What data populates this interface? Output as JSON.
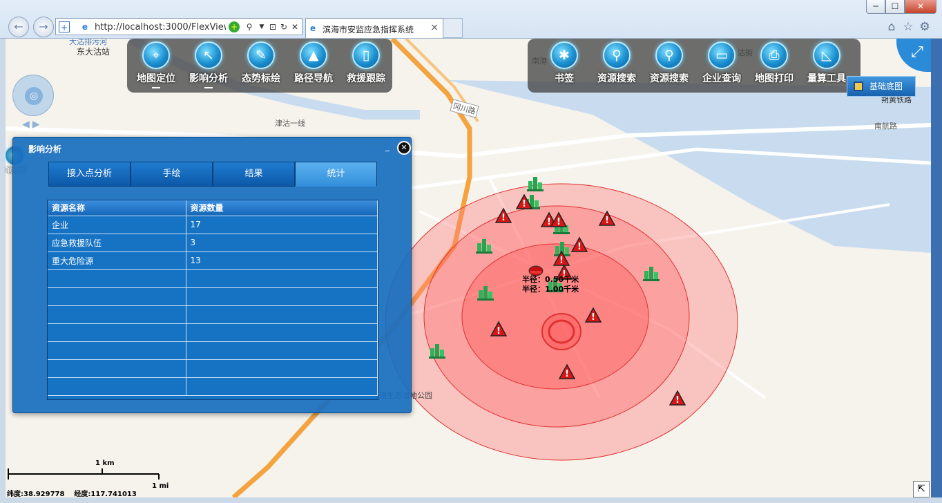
{
  "window": {
    "min": "─",
    "max": "☐",
    "close": "✕"
  },
  "browser": {
    "back_icon": "back-arrow-icon",
    "forward_icon": "forward-arrow-icon",
    "url": "http://localhost:3000/FlexViewer,",
    "tab_title": "滨海市安监应急指挥系统",
    "tab_close": "×",
    "search_glyph": "⚲",
    "refresh_glyph": "↻",
    "stop_glyph": "✕"
  },
  "map_labels": {
    "station": "东大沽站",
    "station_cut": "大沽排污河",
    "road1": "津沽一线",
    "road2": "冈川路",
    "road3": "南航路",
    "road4": "朔黄铁路",
    "road5": "南港",
    "road6": "沽街",
    "park": "临港生态湿地公园",
    "circle_text_1": "半径：0.50千米",
    "circle_text_2": "半径：1.00千米"
  },
  "toolbar_left": [
    {
      "label": "地图定位",
      "icon": "crosshair-icon",
      "glyph": "⌖",
      "active": true
    },
    {
      "label": "影响分析",
      "icon": "pointer-icon",
      "glyph": "↖",
      "active": true
    },
    {
      "label": "态势标绘",
      "icon": "pencil-icon",
      "glyph": "✎",
      "active": false
    },
    {
      "label": "路径导航",
      "icon": "navigation-arrow-icon",
      "glyph": "▲",
      "active": false
    },
    {
      "label": "救援跟踪",
      "icon": "phone-icon",
      "glyph": "▯",
      "active": false
    }
  ],
  "toolbar_right": [
    {
      "label": "书签",
      "icon": "maple-leaf-icon",
      "glyph": "✱"
    },
    {
      "label": "资源搜索",
      "icon": "search-map-icon",
      "glyph": "⚲"
    },
    {
      "label": "资源搜索",
      "icon": "search-map-icon",
      "glyph": "⚲"
    },
    {
      "label": "企业查询",
      "icon": "camera-icon",
      "glyph": "▭"
    },
    {
      "label": "地图打印",
      "icon": "printer-icon",
      "glyph": "⎙"
    },
    {
      "label": "量算工具",
      "icon": "ruler-icon",
      "glyph": "◺"
    }
  ],
  "basemap_label": "基础底图",
  "left_tool_label": "响分析",
  "panel": {
    "title": "影响分析",
    "min": "_",
    "close": "✕",
    "tabs": [
      "接入点分析",
      "手绘",
      "结果",
      "统计"
    ],
    "active_tab": 3,
    "columns": [
      "资源名称",
      "资源数量"
    ],
    "rows": [
      [
        "企业",
        "17"
      ],
      [
        "应急救援队伍",
        "3"
      ],
      [
        "重大危险源",
        "13"
      ]
    ],
    "empty_rows": 7
  },
  "scale": {
    "km": "1 km",
    "mi": "1 mi"
  },
  "coords": {
    "lat_label": "纬度:",
    "lat": "38.929778",
    "lon_label": "经度:",
    "lon": "117.741013"
  },
  "colors": {
    "accent": "#1673c4",
    "buffer": "#ff5a5a",
    "river": "#c7dbee"
  }
}
